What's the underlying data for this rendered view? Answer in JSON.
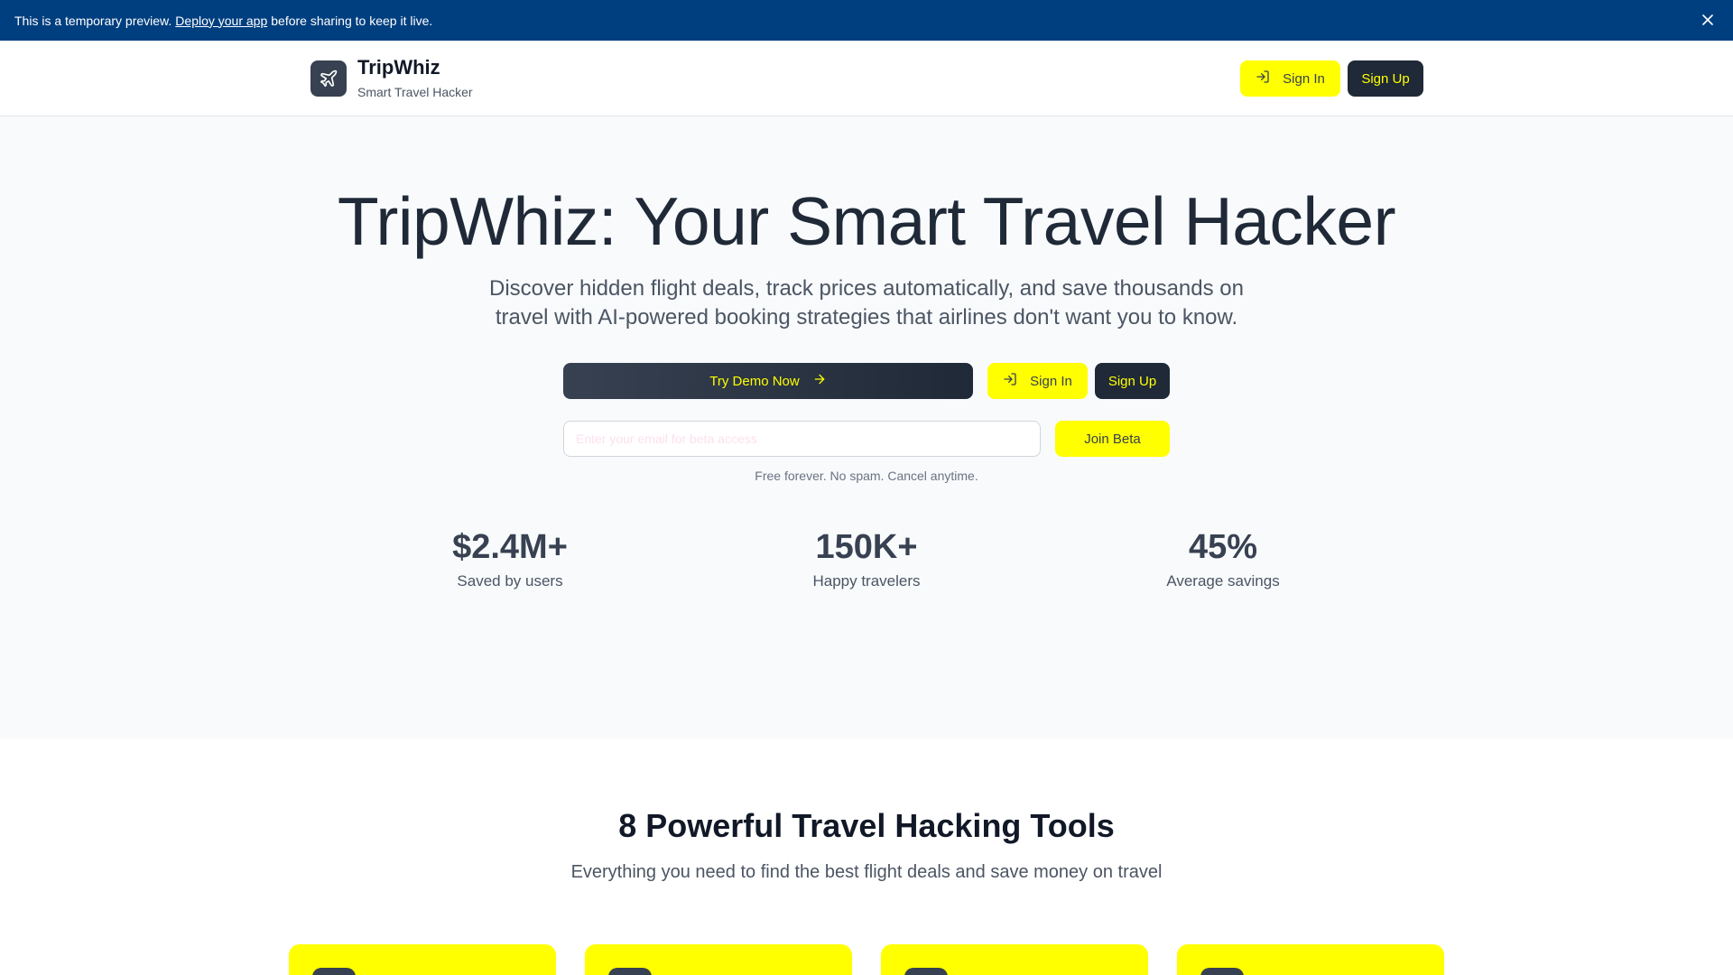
{
  "banner": {
    "text_before": "This is a temporary preview.",
    "link_text": "Deploy your app",
    "text_after": "before sharing to keep it live.",
    "close_icon": "close-icon"
  },
  "header": {
    "brand_title": "TripWhiz",
    "brand_subtitle": "Smart Travel Hacker",
    "logo_icon": "plane-icon",
    "sign_in_label": "Sign In",
    "sign_up_label": "Sign Up"
  },
  "hero": {
    "title": "TripWhiz: Your Smart Travel Hacker",
    "description": "Discover hidden flight deals, track prices automatically, and save thousands on travel with AI-powered booking strategies that airlines don't want you to know.",
    "try_demo_label": "Try Demo Now",
    "sign_in_label": "Sign In",
    "sign_up_label": "Sign Up",
    "email_placeholder": "Enter your email for beta access",
    "join_beta_label": "Join Beta",
    "fine_print": "Free forever. No spam. Cancel anytime.",
    "stats": [
      {
        "value": "$2.4M+",
        "label": "Saved by users"
      },
      {
        "value": "150K+",
        "label": "Happy travelers"
      },
      {
        "value": "45%",
        "label": "Average savings"
      }
    ]
  },
  "tools": {
    "title": "8 Powerful Travel Hacking Tools",
    "subtitle": "Everything you need to find the best flight deals and save money on travel"
  },
  "colors": {
    "banner": "#003f7f",
    "accent_yellow": "#ffff00",
    "dark": "#1f2937"
  }
}
